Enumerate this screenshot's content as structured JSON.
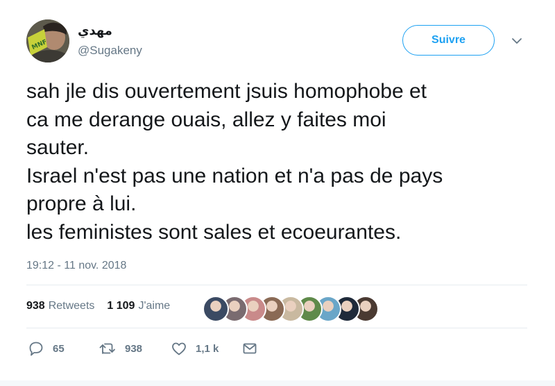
{
  "user": {
    "display_name": "مهدي",
    "handle": "@Sugakeny",
    "avatar_badge_text": "MNF"
  },
  "follow_label": "Suivre",
  "tweet": {
    "lines": [
      "sah jle dis ouvertement jsuis homophobe et",
      "ca me derange ouais, allez y faites moi",
      "sauter.",
      "Israel n'est pas une nation et n'a pas de pays",
      "propre à lui.",
      "les feministes sont sales et ecoeurantes."
    ],
    "timestamp": "19:12 - 11 nov. 2018"
  },
  "stats": {
    "retweets_count": "938",
    "retweets_label": "Retweets",
    "likes_count": "1 109",
    "likes_label": "J'aime"
  },
  "likers": [
    {
      "color": "#3b4a63"
    },
    {
      "color": "#7a6b70"
    },
    {
      "color": "#c98a8a"
    },
    {
      "color": "#8a6a55"
    },
    {
      "color": "#c9b9a0"
    },
    {
      "color": "#5f8a4a"
    },
    {
      "color": "#6aa6c8"
    },
    {
      "color": "#1f2a3a"
    },
    {
      "color": "#4a3a32"
    }
  ],
  "actions": {
    "reply_count": "65",
    "retweet_count": "938",
    "like_count": "1,1 k"
  },
  "colors": {
    "accent": "#1da1f2",
    "secondary_text": "#657786",
    "primary_text": "#14171a"
  },
  "icons": {
    "reply": "reply-icon",
    "retweet": "retweet-icon",
    "like": "heart-icon",
    "dm": "envelope-icon",
    "menu": "chevron-down-icon"
  }
}
